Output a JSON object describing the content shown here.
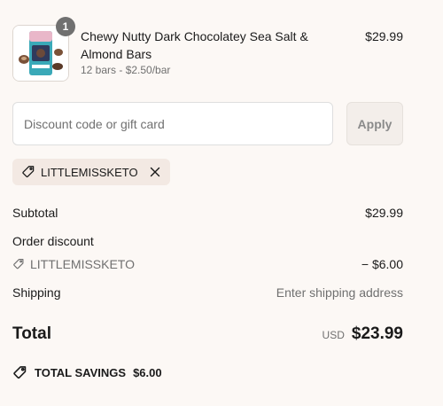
{
  "product": {
    "name": "Chewy Nutty Dark Chocolatey Sea Salt & Almond Bars",
    "variant": "12 bars - $2.50/bar",
    "price": "$29.99",
    "quantity": "1",
    "image_icon": "product-package-image"
  },
  "discount_form": {
    "placeholder": "Discount code or gift card",
    "value": "",
    "apply_label": "Apply"
  },
  "applied_code": {
    "code": "LITTLEMISSKETO",
    "tag_icon": "tag-icon",
    "remove_icon": "close-icon"
  },
  "summary": {
    "subtotal_label": "Subtotal",
    "subtotal_value": "$29.99",
    "order_discount_label": "Order discount",
    "discount_code": "LITTLEMISSKETO",
    "discount_value": "− $6.00",
    "shipping_label": "Shipping",
    "shipping_value": "Enter shipping address",
    "total_label": "Total",
    "currency": "USD",
    "total_value": "$23.99",
    "savings_label": "TOTAL SAVINGS",
    "savings_value": "$6.00"
  },
  "colors": {
    "background": "#fcf8f5",
    "chip_background": "#f3e9e3",
    "muted_text": "#707070",
    "badge": "#707070"
  }
}
